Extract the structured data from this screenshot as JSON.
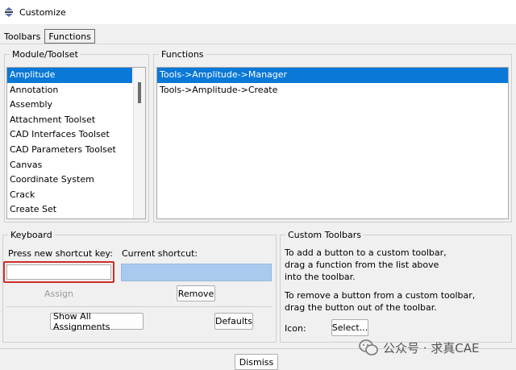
{
  "window": {
    "title": "Customize"
  },
  "tabs": [
    {
      "label": "Toolbars",
      "active": false
    },
    {
      "label": "Functions",
      "active": true
    }
  ],
  "module_toolset": {
    "label": "Module/Toolset",
    "items": [
      "Amplitude",
      "Annotation",
      "Assembly",
      "Attachment Toolset",
      "CAD Interfaces Toolset",
      "CAD Parameters Toolset",
      "Canvas",
      "Coordinate System",
      "Crack",
      "Create Set"
    ],
    "selected": "Amplitude"
  },
  "functions": {
    "label": "Functions",
    "items": [
      "Tools->Amplitude->Manager",
      "Tools->Amplitude->Create"
    ],
    "selected": "Tools->Amplitude->Manager"
  },
  "keyboard": {
    "label": "Keyboard",
    "new_key_label": "Press new shortcut key:",
    "new_key_value": "",
    "current_label": "Current shortcut:",
    "current_value": "",
    "assign_label": "Assign",
    "remove_label": "Remove",
    "show_all_label": "Show All Assignments",
    "defaults_label": "Defaults"
  },
  "custom_toolbars": {
    "label": "Custom Toolbars",
    "add_text": [
      "To add a button to a custom toolbar,",
      "drag a function from the list above",
      "into the toolbar."
    ],
    "remove_text": [
      "To remove a button from a custom toolbar,",
      "drag the button out of the toolbar."
    ],
    "icon_label": "Icon:",
    "select_label": "Select..."
  },
  "dismiss_label": "Dismiss",
  "watermark": {
    "text": "公众号 · 求真CAE"
  },
  "colors": {
    "selection": "#0a78d7",
    "current_shortcut": "#aac9ee",
    "highlight_border": "#d22b2b"
  }
}
